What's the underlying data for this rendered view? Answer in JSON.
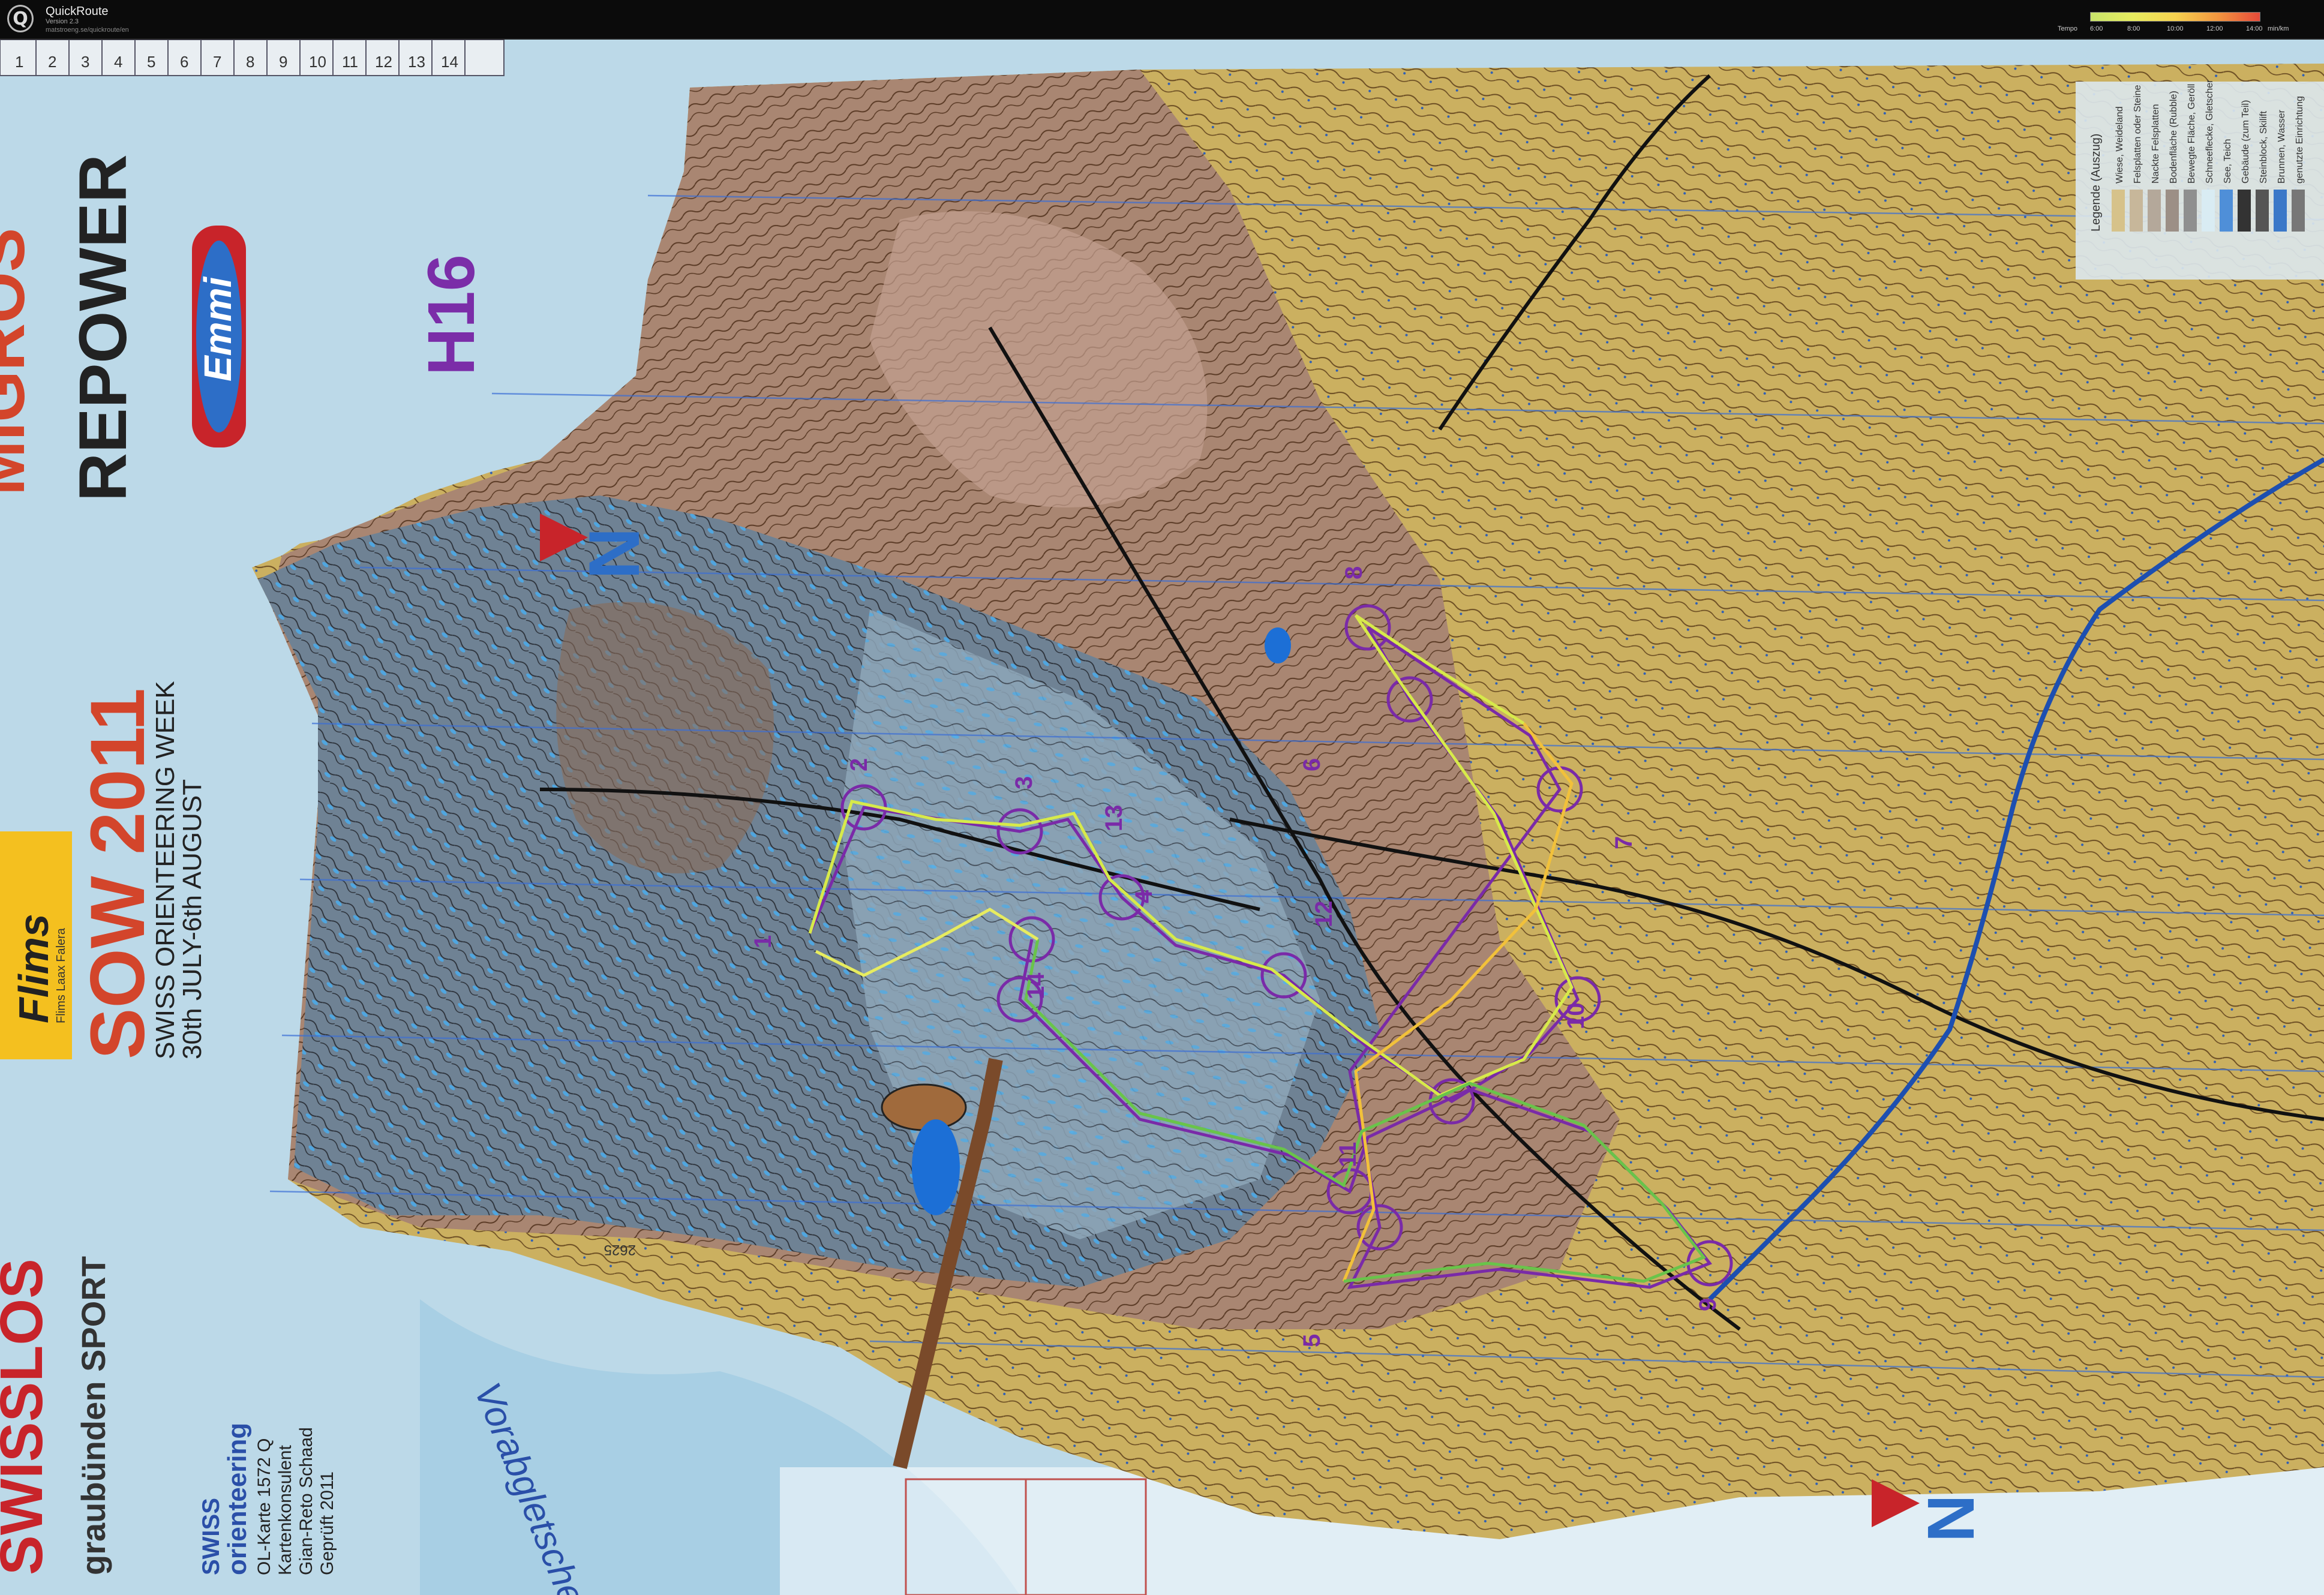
{
  "app": {
    "title": "QuickRoute",
    "version": "Version 2.3",
    "url": "matstroeng.se/quickroute/en",
    "logo_letter": "Q"
  },
  "speed_legend": {
    "title": "Tempo",
    "ticks": [
      "6:00",
      "8:00",
      "10:00",
      "12:00",
      "14:00"
    ],
    "unit": "min/km",
    "colors": [
      "#c8e46a",
      "#e7ec5f",
      "#f7d24f",
      "#f2963f",
      "#e64a3a"
    ]
  },
  "map": {
    "grid_numbers": [
      "1",
      "2",
      "3",
      "4",
      "5",
      "6",
      "7",
      "8",
      "9",
      "10",
      "11",
      "12",
      "13",
      "14"
    ],
    "class_label": "H16",
    "event_title": "SOW 2011",
    "event_subtitle": "SWISS ORIENTEERING WEEK",
    "event_dates": "30th JULY-6th AUGUST",
    "sponsor_migros": "MIGROS",
    "sponsor_repower": "REPOWER",
    "sponsor_emmi": "Emmi",
    "sponsor_flims": "Flims",
    "sponsor_flims_tag": "Flims Laax Falera",
    "sponsor_swisslos": "SWISSLOS",
    "sponsor_graubunden": "graubünden SPORT",
    "federation_line1": "SWISS",
    "federation_line2": "orienteering",
    "map_info": [
      "OL-Karte 1572 Q",
      "Kartenkonsulent",
      "Gian-Reto Schaad",
      "Geprüft 2011"
    ],
    "glacier_name": "Vorabgletscher",
    "north_marker": "N",
    "spot_height": "2625",
    "legend_box_title": "Legende (Auszug)",
    "legend_box_items": [
      "Wiese, Weideland",
      "Felsplatten oder Steine",
      "Nackte Felsplatten",
      "Bodenfläche (Rubble)",
      "Bewegte Fläche, Geröll",
      "Schneeflecke, Gletscher",
      "See, Teich",
      "Gebäude (zum Teil)",
      "Steinblock, Skilift",
      "Brunnen, Wasser",
      "genutzte Einrichtung"
    ],
    "legend_box_colors": [
      "#d6c28a",
      "#c7b79a",
      "#b4a89a",
      "#9c8f86",
      "#8f8f8f",
      "#d9ecf3",
      "#4f8fd8",
      "#333333",
      "#555555",
      "#3b78c8",
      "#777777"
    ],
    "control_numbers": [
      "1",
      "2",
      "3",
      "4",
      "5",
      "6",
      "7",
      "8",
      "9",
      "10",
      "11",
      "12",
      "13",
      "14"
    ],
    "course_color": "#7a2aa8",
    "route_colors": [
      "#d7ea4a",
      "#f2c13a",
      "#69c44a"
    ]
  }
}
